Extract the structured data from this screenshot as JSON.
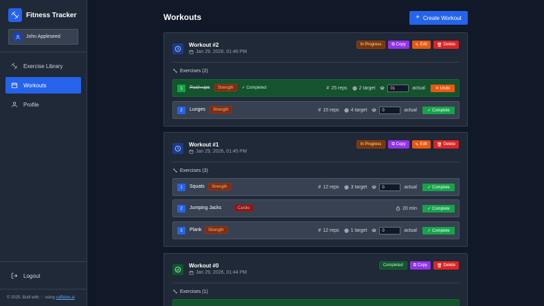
{
  "app": {
    "title": "Fitness Tracker",
    "user": "John Appleseed"
  },
  "sidebar": {
    "items": [
      {
        "label": "Exercise Library",
        "icon": "dumbbell-icon",
        "active": false
      },
      {
        "label": "Workouts",
        "icon": "calendar-icon",
        "active": true
      },
      {
        "label": "Profile",
        "icon": "user-icon",
        "active": false
      }
    ],
    "logout": "Logout",
    "footer": {
      "prefix": "© 2025. Built with",
      "heart": "♡",
      "mid": "using",
      "link": "caffeine.ai"
    }
  },
  "main": {
    "title": "Workouts",
    "create_label": "Create Workout",
    "buttons": {
      "copy": "Copy",
      "edit": "Edit",
      "delete": "Delete",
      "complete": "✓ Complete",
      "undo": "✕ Undo",
      "actual": "actual"
    },
    "workouts": [
      {
        "title": "Workout #2",
        "date": "Jan 29, 2026, 01:46 PM",
        "status": "In Progress",
        "exercises_header": "Exercises (2)",
        "exercises": [
          {
            "num": "1",
            "name": "Push-ups",
            "tag": "Strength",
            "completed": true,
            "done_text": "✓ Completed",
            "reps": "25 reps",
            "target": "2 target",
            "actual": "01"
          },
          {
            "num": "2",
            "name": "Lunges",
            "tag": "Strength",
            "completed": false,
            "reps": "15 reps",
            "target": "4 target",
            "actual": "0"
          }
        ]
      },
      {
        "title": "Workout #1",
        "date": "Jan 29, 2026, 01:45 PM",
        "status": "In Progress",
        "exercises_header": "Exercises (3)",
        "exercises": [
          {
            "num": "1",
            "name": "Squats",
            "tag": "Strength",
            "completed": false,
            "reps": "12 reps",
            "target": "3 target",
            "actual": "0"
          },
          {
            "num": "2",
            "name": "Jumping Jacks",
            "tag": "Cardio",
            "completed": false,
            "duration": "20 min"
          },
          {
            "num": "3",
            "name": "Plank",
            "tag": "Strength",
            "completed": false,
            "reps": "12 reps",
            "target": "1 target",
            "actual": "0"
          }
        ]
      },
      {
        "title": "Workout #0",
        "date": "Jan 29, 2026, 01:44 PM",
        "status": "Completed",
        "exercises_header": "Exercises (1)",
        "exercises": []
      }
    ]
  },
  "colors": {
    "accent": "#2563eb",
    "complete": "#16a34a",
    "edit": "#ea580c",
    "delete": "#dc2626",
    "copy": "#9333ea"
  }
}
